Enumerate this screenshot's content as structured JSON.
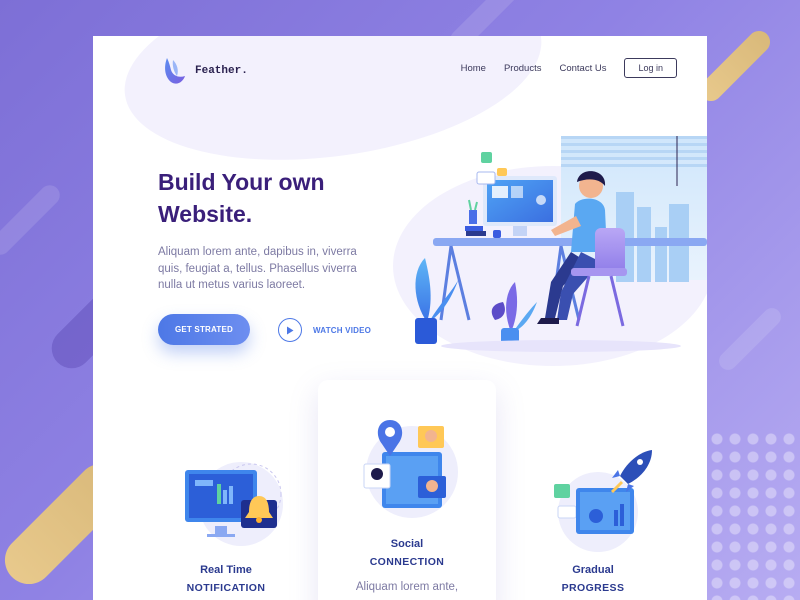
{
  "brand": {
    "name": "Feather."
  },
  "nav": {
    "items": [
      "Home",
      "Products",
      "Contact Us"
    ],
    "login_label": "Log in"
  },
  "hero": {
    "title_line1": "Build Your own",
    "title_line2": "Website.",
    "description": "Aliquam lorem ante, dapibus in, viverra quis, feugiat a, tellus. Phasellus viverra nulla ut metus varius laoreet.",
    "cta_label": "GET STRATED",
    "watch_label": "WATCH VIDEO"
  },
  "features": [
    {
      "line1": "Real Time",
      "line2": "NOTIFICATION",
      "icon": "monitor-bell-icon"
    },
    {
      "line1": "Social",
      "line2": "CONNECTION",
      "description": "Aliquam lorem ante,",
      "icon": "location-people-icon"
    },
    {
      "line1": "Gradual",
      "line2": "PROGRESS",
      "icon": "rocket-chart-icon"
    }
  ],
  "colors": {
    "background": "#8f82e4",
    "accent": "#4d78e6",
    "title": "#3a1f7a",
    "feature_text": "#2b3a8f"
  }
}
